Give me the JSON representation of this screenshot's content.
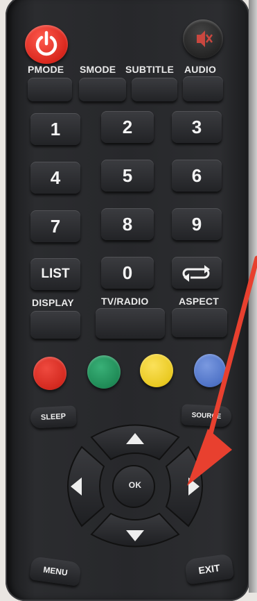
{
  "remote": {
    "top_row": {
      "power_icon": "power-icon",
      "mute_icon": "mute-icon",
      "labels": [
        "PMODE",
        "SMODE",
        "SUBTITLE",
        "AUDIO"
      ]
    },
    "numbers": [
      "1",
      "2",
      "3",
      "4",
      "5",
      "6",
      "7",
      "8",
      "9"
    ],
    "list_label": "LIST",
    "zero_label": "0",
    "swap_icon": "swap-arrows-icon",
    "bottom_labels": [
      "DISPLAY",
      "TV/RADIO",
      "ASPECT"
    ],
    "color_buttons": [
      {
        "name": "red",
        "color": "#d3291f"
      },
      {
        "name": "green",
        "color": "#1f8a56"
      },
      {
        "name": "yellow",
        "color": "#e9c921"
      },
      {
        "name": "blue",
        "color": "#4f73c7"
      }
    ],
    "sleep_label": "SLEEP",
    "source_label": "SOURCE",
    "ok_label": "OK",
    "menu_label": "MENU",
    "exit_label": "EXIT"
  },
  "annotation": {
    "arrow_color": "#e8402f"
  }
}
